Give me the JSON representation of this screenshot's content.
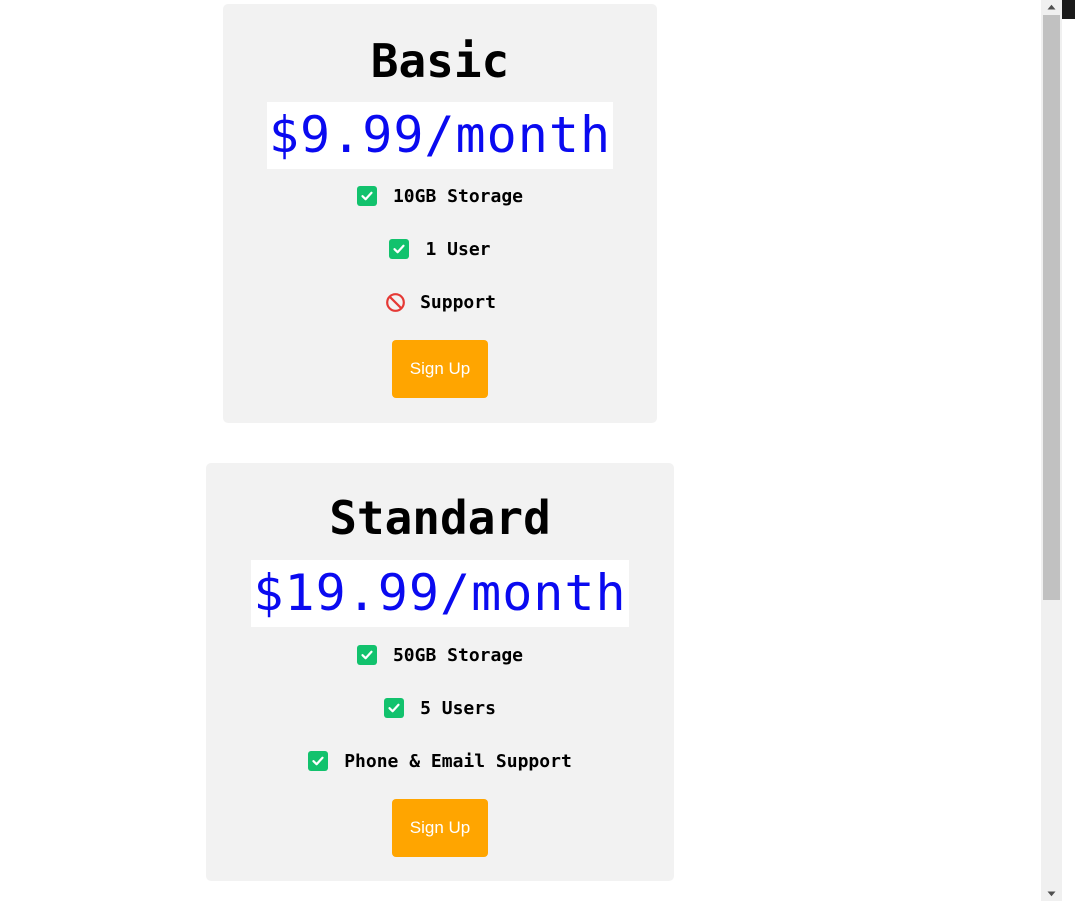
{
  "plans": [
    {
      "name": "Basic",
      "price": "$9.99/month",
      "features": [
        {
          "text": "10GB Storage",
          "included": true,
          "icon": "check-icon"
        },
        {
          "text": "1 User",
          "included": true,
          "icon": "check-icon"
        },
        {
          "text": "Support",
          "included": false,
          "icon": "prohibited-icon"
        }
      ],
      "cta": "Sign Up"
    },
    {
      "name": "Standard",
      "price": "$19.99/month",
      "features": [
        {
          "text": "50GB Storage",
          "included": true,
          "icon": "check-icon"
        },
        {
          "text": "5 Users",
          "included": true,
          "icon": "check-icon"
        },
        {
          "text": "Phone & Email Support",
          "included": true,
          "icon": "check-icon"
        }
      ],
      "cta": "Sign Up"
    }
  ],
  "colors": {
    "card_bg": "#f2f2f2",
    "price": "#0a0af0",
    "check": "#12c26d",
    "prohibited": "#e53935",
    "button": "#ffa500",
    "button_text": "#ffffff"
  }
}
